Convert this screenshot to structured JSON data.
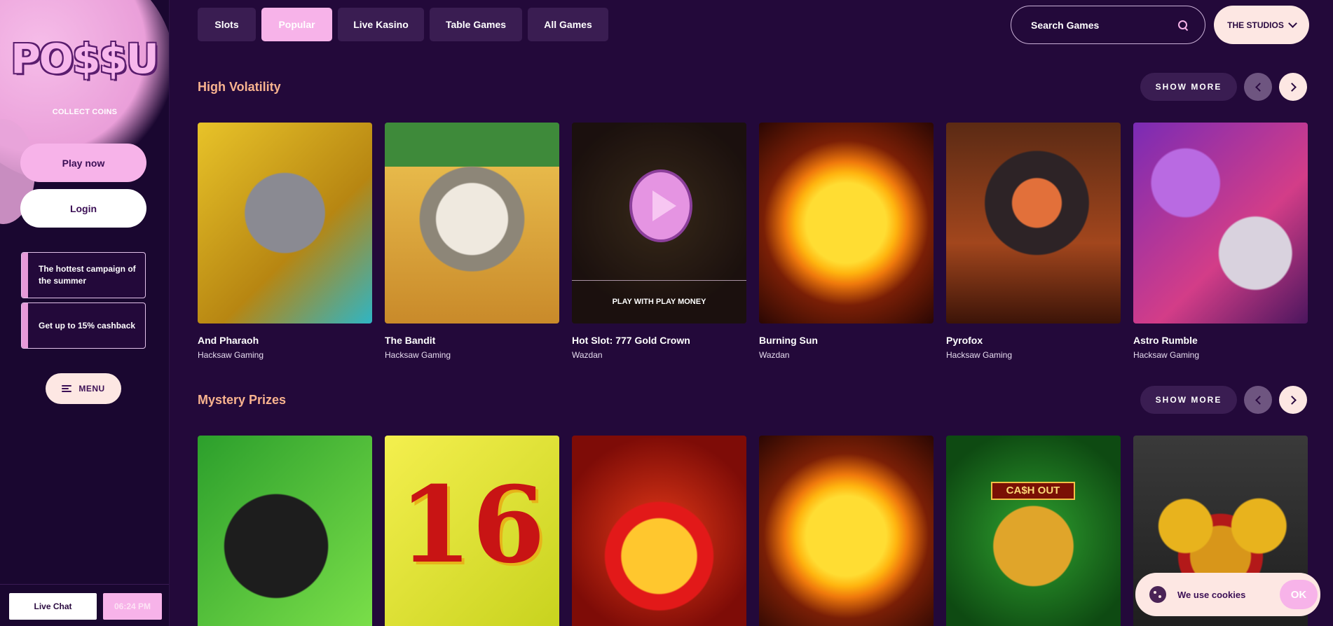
{
  "sidebar": {
    "logo": "PO$$U",
    "collect": "COLLECT COINS",
    "play_now": "Play now",
    "login": "Login",
    "promos": [
      "The hottest campaign of the summer",
      "Get up to 15% cashback"
    ],
    "menu": "MENU",
    "live_chat": "Live Chat",
    "clock": "06:24 PM"
  },
  "nav": {
    "tabs": [
      "Slots",
      "Popular",
      "Live Kasino",
      "Table Games",
      "All Games"
    ],
    "active_tab": "Popular",
    "search_placeholder": "Search Games",
    "studios": "THE STUDIOS"
  },
  "sections": [
    {
      "title": "High Volatility",
      "show_more": "SHOW MORE",
      "games": [
        {
          "name": "And Pharaoh",
          "studio": "Hacksaw Gaming"
        },
        {
          "name": "The Bandit",
          "studio": "Hacksaw Gaming"
        },
        {
          "name": "Hot Slot: 777 Gold Crown",
          "studio": "Wazdan",
          "overlay": "PLAY WITH PLAY MONEY"
        },
        {
          "name": "Burning Sun",
          "studio": "Wazdan"
        },
        {
          "name": "Pyrofox",
          "studio": "Hacksaw Gaming"
        },
        {
          "name": "Astro Rumble",
          "studio": "Hacksaw Gaming"
        }
      ]
    },
    {
      "title": "Mystery Prizes",
      "show_more": "SHOW MORE",
      "tiles": {
        "sixteen": "16",
        "cashout": "CA$H OUT"
      }
    }
  ],
  "cookie": {
    "text": "We use cookies",
    "ok": "OK"
  },
  "colors": {
    "accent_pink": "#f7b3e9",
    "section_title": "#f8b38f",
    "background": "#23093a"
  }
}
